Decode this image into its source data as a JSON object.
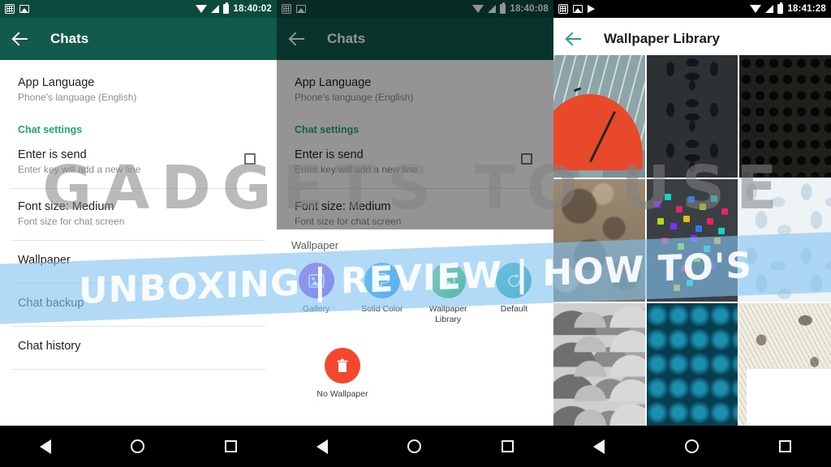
{
  "panels": [
    {
      "status": {
        "time": "18:40:02",
        "icons": [
          "grid-icon",
          "photo-icon"
        ],
        "right_icons": [
          "wifi-icon",
          "signal-icon",
          "battery-icon"
        ]
      },
      "appbar": {
        "title": "Chats",
        "back": "back-arrow"
      },
      "settings": {
        "app_language": {
          "title": "App Language",
          "sub": "Phone's language (English)"
        },
        "section": "Chat settings",
        "enter_is_send": {
          "title": "Enter is send",
          "sub": "Enter key will add a new line"
        },
        "font_size": {
          "title": "Font size: Medium",
          "sub": "Font size for chat screen"
        },
        "wallpaper": "Wallpaper",
        "chat_backup": "Chat backup",
        "chat_history": "Chat history"
      }
    },
    {
      "status": {
        "time": "18:40:08"
      },
      "appbar": {
        "title": "Chats"
      },
      "sheet": {
        "title": "Wallpaper",
        "options": [
          {
            "label": "Gallery",
            "icon": "gallery-icon",
            "glyph": "ὛC"
          },
          {
            "label": "Solid Color",
            "icon": "palette-icon",
            "glyph": "◑"
          },
          {
            "label": "Wallpaper Library",
            "icon": "whatsapp-icon",
            "glyph": "✆"
          },
          {
            "label": "Default",
            "icon": "refresh-icon",
            "glyph": "↺"
          }
        ],
        "no_wallpaper": {
          "label": "No Wallpaper",
          "icon": "trash-icon",
          "glyph": "Ὕ1"
        }
      }
    },
    {
      "status": {
        "time": "18:41:28",
        "icons": [
          "grid-icon",
          "photo-icon",
          "flag-icon"
        ]
      },
      "appbar": {
        "title": "Wallpaper Library"
      },
      "gallery": {
        "thumbnails": [
          {
            "name": "red-umbrella-rain",
            "style": "w-umbrella"
          },
          {
            "name": "dark-damask-pattern",
            "style": "w-damask"
          },
          {
            "name": "dark-diamond-lattice",
            "style": "w-diamond-dark"
          },
          {
            "name": "lunar-rock-surface",
            "style": "w-rock"
          },
          {
            "name": "colorful-pixel-blocks",
            "style": "w-pixels"
          },
          {
            "name": "light-leaf-pattern",
            "style": "w-leaves-light"
          },
          {
            "name": "grey-cloud-scallops",
            "style": "w-clouds"
          },
          {
            "name": "teal-diamond-pattern",
            "style": "w-teal"
          },
          {
            "name": "botanical-leaf-sketch",
            "style": "w-botanical"
          }
        ]
      }
    }
  ],
  "navbar": {
    "back": "nav-back-icon",
    "home": "nav-home-icon",
    "recents": "nav-recents-icon"
  },
  "watermark": {
    "top": "GADGETS TO USE",
    "band": "UNBOXING | REVIEW | HOW TO'S"
  },
  "colors": {
    "appbar_green": "#115a4c",
    "statusbar_green": "#0d4a3e",
    "accent_green": "#1fa37a",
    "delete_red": "#f4472b"
  }
}
